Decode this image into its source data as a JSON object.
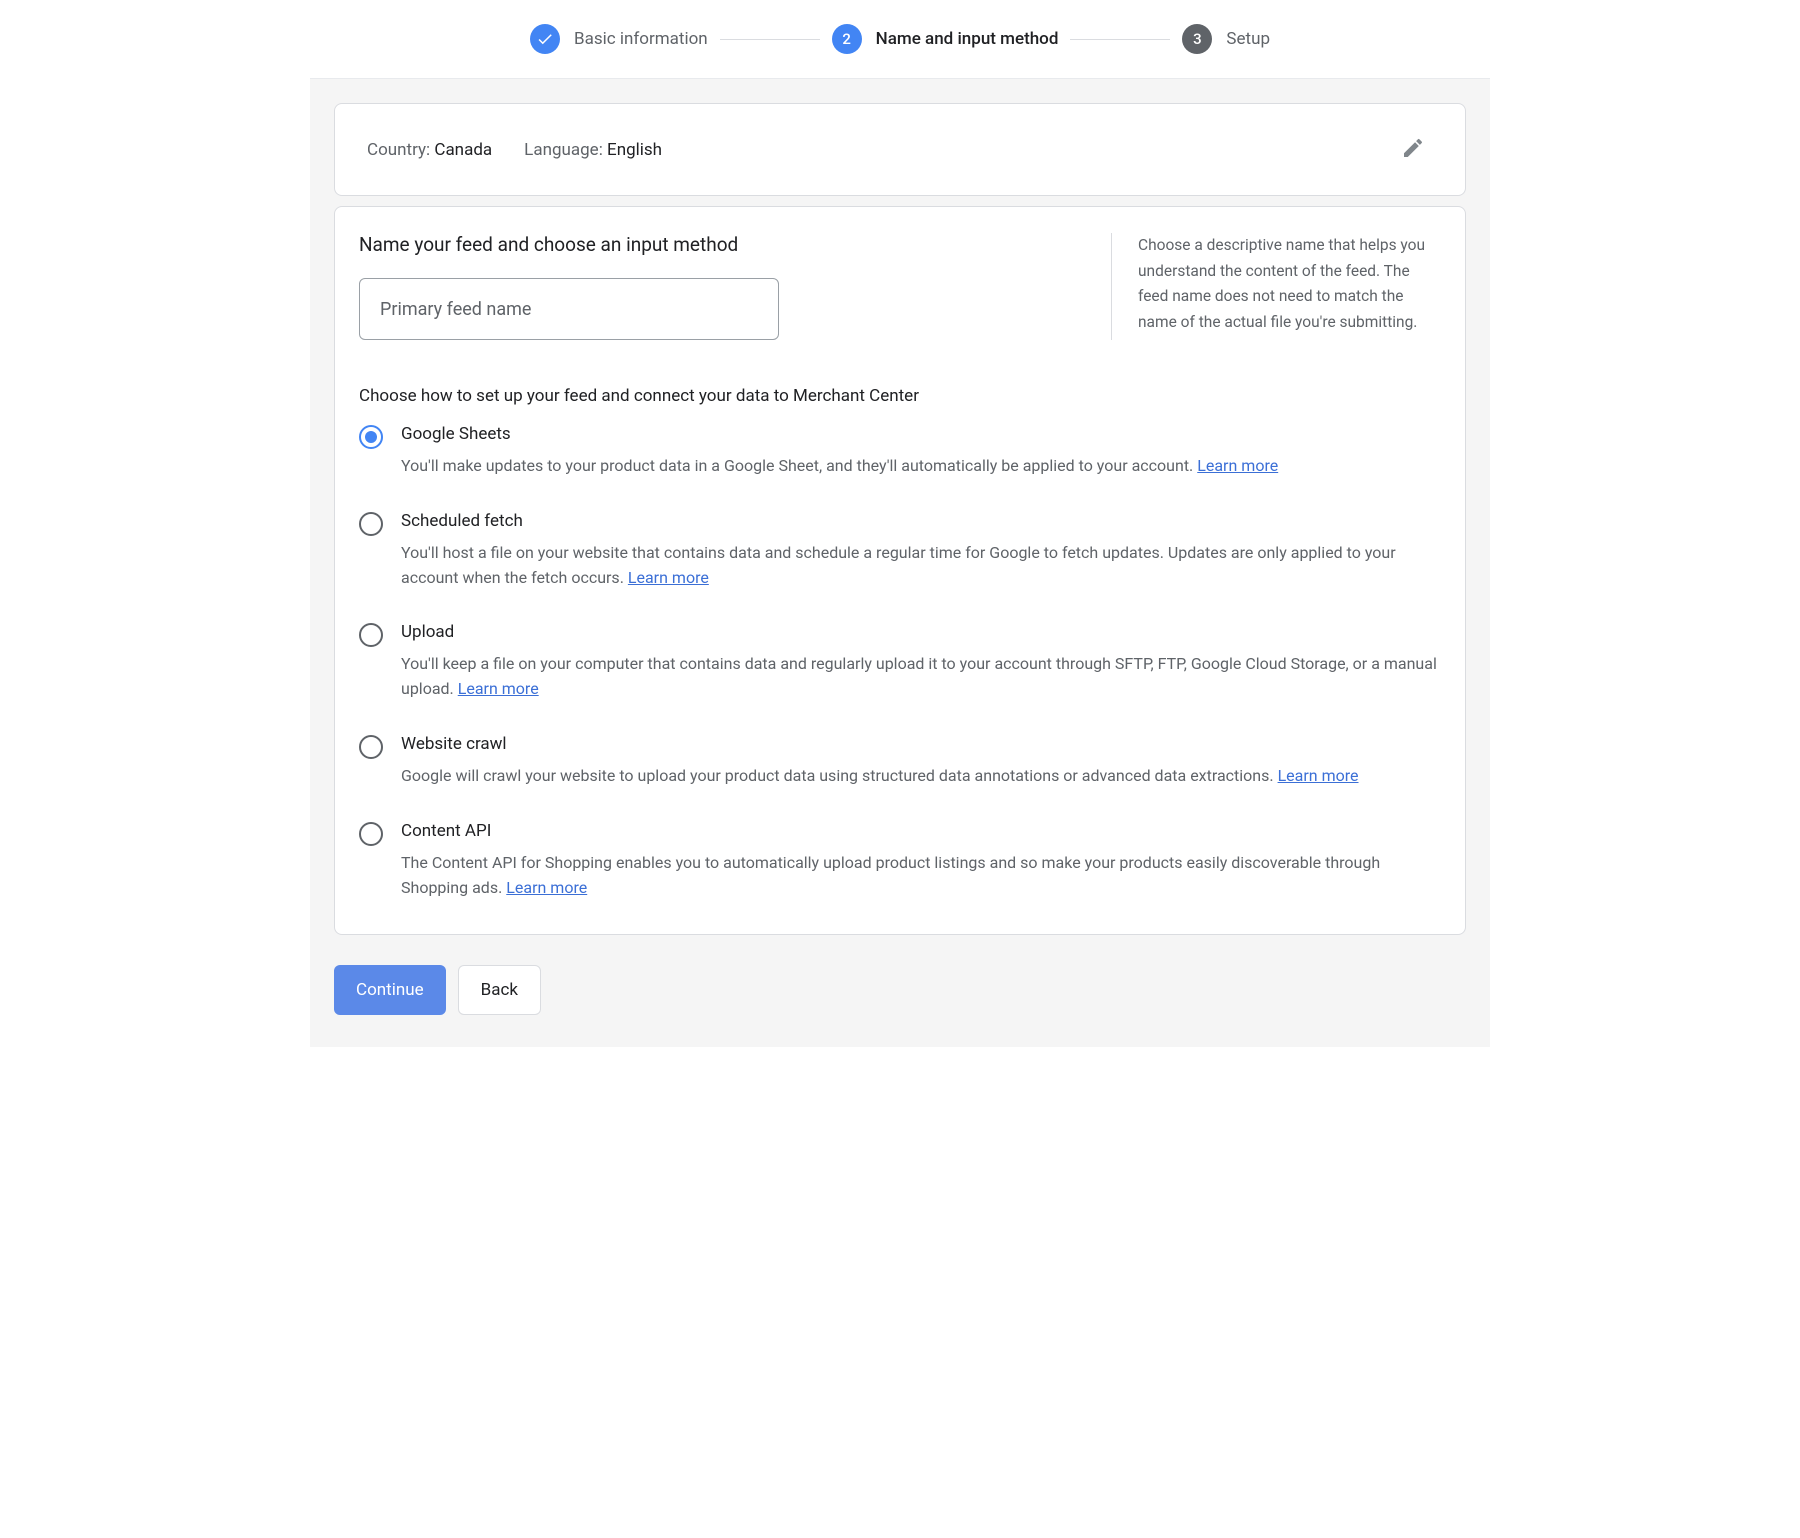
{
  "stepper": {
    "steps": [
      {
        "label": "Basic information",
        "state": "done",
        "number": ""
      },
      {
        "label": "Name and input method",
        "state": "active",
        "number": "2"
      },
      {
        "label": "Setup",
        "state": "pending",
        "number": "3"
      }
    ]
  },
  "summary": {
    "country_label": "Country: ",
    "country_value": "Canada",
    "language_label": "Language: ",
    "language_value": "English"
  },
  "main": {
    "title": "Name your feed and choose an input method",
    "feed_name_placeholder": "Primary feed name",
    "feed_name_value": "",
    "help_text": "Choose a descriptive name that helps you understand the content of the feed. The feed name does not need to match the name of the actual file you're submitting.",
    "method_title": "Choose how to set up your feed and connect your data to Merchant Center",
    "learn_more_label": "Learn more",
    "options": [
      {
        "title": "Google Sheets",
        "desc": "You'll make updates to your product data in a Google Sheet, and they'll automatically be applied to your account. ",
        "selected": true
      },
      {
        "title": "Scheduled fetch",
        "desc": "You'll host a file on your website that contains data and schedule a regular time for Google to fetch updates. Updates are only applied to your account when the fetch occurs. ",
        "selected": false
      },
      {
        "title": "Upload",
        "desc": "You'll keep a file on your computer that contains data and regularly upload it to your account through SFTP, FTP, Google Cloud Storage, or a manual upload. ",
        "selected": false
      },
      {
        "title": "Website crawl",
        "desc": "Google will crawl your website to upload your product data using structured data annotations or advanced data extractions. ",
        "selected": false
      },
      {
        "title": "Content API",
        "desc": "The Content API for Shopping enables you to automatically upload product listings and so make your products easily discoverable through Shopping ads. ",
        "selected": false
      }
    ]
  },
  "buttons": {
    "continue": "Continue",
    "back": "Back"
  },
  "colors": {
    "primary": "#4285f4",
    "text": "#202124",
    "muted": "#5f6368",
    "link": "#3b6fd6",
    "border": "#dadce0"
  }
}
